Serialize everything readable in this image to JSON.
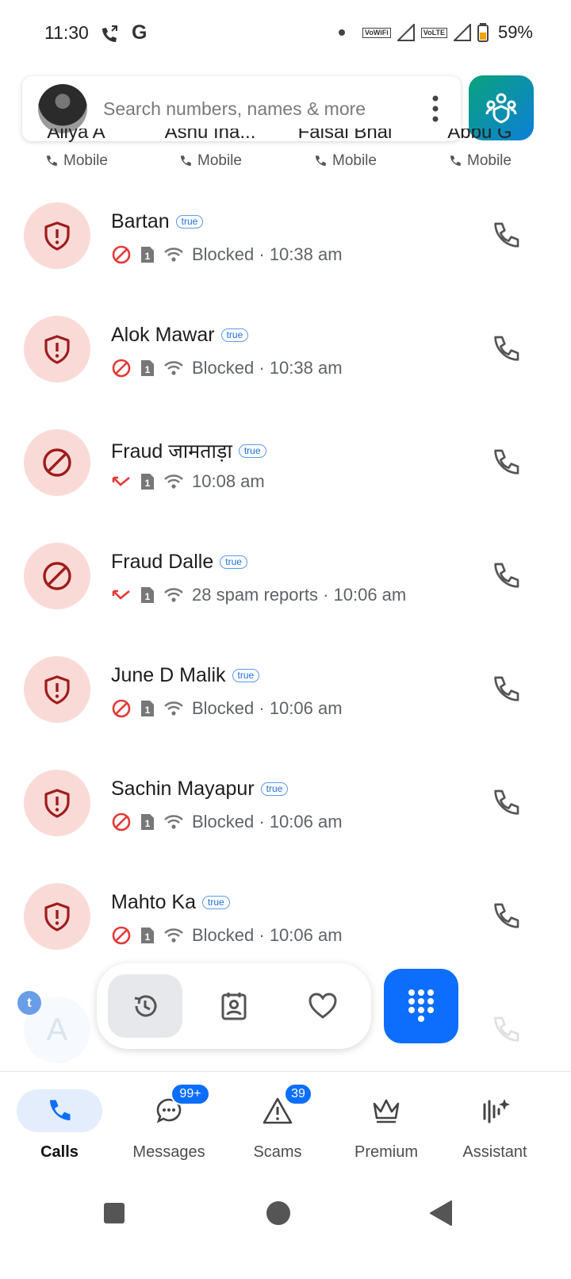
{
  "status_bar": {
    "time": "11:30",
    "battery": "59%",
    "tag1": "VoWiFi",
    "tag2": "VoLTE"
  },
  "search": {
    "placeholder": "Search numbers, names & more"
  },
  "favorites": [
    {
      "name": "Aliya A",
      "type": "Mobile"
    },
    {
      "name": "Ashu Ina...",
      "type": "Mobile"
    },
    {
      "name": "Faisal Bhai",
      "type": "Mobile"
    },
    {
      "name": "Abbu G",
      "type": "Mobile"
    }
  ],
  "calls": [
    {
      "name": "Bartan",
      "badge": "true",
      "icon": "shield-icon",
      "status_icon": "blocked-icon",
      "detail": "Blocked · 10:38 am"
    },
    {
      "name": "Alok Mawar",
      "badge": "true",
      "icon": "shield-icon",
      "status_icon": "blocked-icon",
      "detail": "Blocked · 10:38 am"
    },
    {
      "name": "Fraud जामताड़ा",
      "badge": "true",
      "icon": "block-icon",
      "status_icon": "missed-call-icon",
      "detail": "10:08 am"
    },
    {
      "name": "Fraud Dalle",
      "badge": "true",
      "icon": "block-icon",
      "status_icon": "missed-call-icon",
      "detail": "28 spam reports · 10:06 am"
    },
    {
      "name": "June D Malik",
      "badge": "true",
      "icon": "shield-icon",
      "status_icon": "blocked-icon",
      "detail": "Blocked · 10:06 am"
    },
    {
      "name": "Sachin Mayapur",
      "badge": "true",
      "icon": "shield-icon",
      "status_icon": "blocked-icon",
      "detail": "Blocked · 10:06 am"
    },
    {
      "name": "Mahto Ka",
      "badge": "true",
      "icon": "shield-icon",
      "status_icon": "blocked-icon",
      "detail": "Blocked · 10:06 am"
    }
  ],
  "partial_row": {
    "avatar_letter": "A",
    "bubble_letter": "t"
  },
  "bottom_nav": [
    {
      "label": "Calls",
      "icon": "phone-icon",
      "active": true
    },
    {
      "label": "Messages",
      "icon": "chat-icon",
      "badge": "99+"
    },
    {
      "label": "Scams",
      "icon": "warning-icon",
      "badge": "39"
    },
    {
      "label": "Premium",
      "icon": "crown-icon"
    },
    {
      "label": "Assistant",
      "icon": "assistant-icon"
    }
  ],
  "colors": {
    "accent": "#0d6efd",
    "spam_bg": "#fadad7",
    "spam_red": "#e53935"
  }
}
